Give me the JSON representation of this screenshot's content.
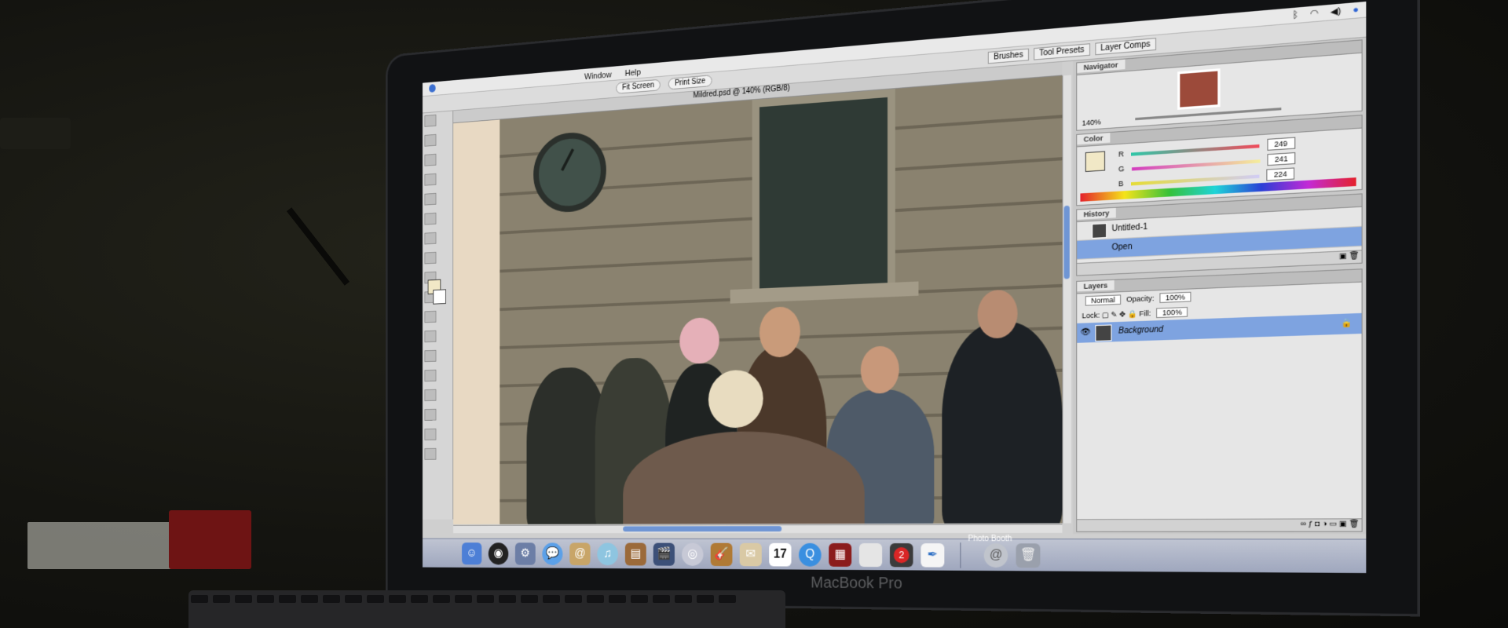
{
  "menubar": {
    "items": [
      "Window",
      "Help"
    ]
  },
  "options_bar": {
    "buttons": [
      "Fit Screen",
      "Print Size"
    ]
  },
  "palette_well": [
    "Brushes",
    "Tool Presets",
    "Layer Comps"
  ],
  "document": {
    "title": "Mildred.psd @ 140% (RGB/8)"
  },
  "navigator": {
    "tab": "Navigator",
    "zoom": "140%"
  },
  "color": {
    "tab": "Color",
    "r_label": "R",
    "r_value": "249",
    "g_label": "G",
    "g_value": "241",
    "b_label": "B",
    "b_value": "224",
    "swatch": "#f1e8c6"
  },
  "history": {
    "tab": "History",
    "items": [
      "Untitled-1",
      "Open"
    ]
  },
  "layers": {
    "tab": "Layers",
    "blend_mode": "Normal",
    "opacity_label": "Opacity:",
    "opacity_value": "100%",
    "lock_label": "Lock:",
    "fill_label": "Fill:",
    "fill_value": "100%",
    "layer_name": "Background"
  },
  "dock": {
    "calendar_day": "17",
    "badge_count": "2",
    "caption": "Photo Booth"
  },
  "laptop": {
    "brand": "MacBook Pro"
  }
}
